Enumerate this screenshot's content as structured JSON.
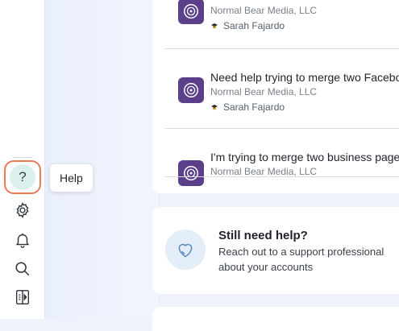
{
  "sidebar": {
    "help_tooltip": "Help",
    "icons": [
      "help-icon",
      "settings-icon",
      "bell-icon",
      "search-icon",
      "panel-toggle-icon"
    ]
  },
  "threads": [
    {
      "title": "",
      "org": "Normal Bear Media, LLC",
      "person": "Sarah Fajardo"
    },
    {
      "title": "Need help trying to merge two Facebook",
      "org": "Normal Bear Media, LLC",
      "person": "Sarah Fajardo"
    },
    {
      "title": "I'm trying to merge two business pages",
      "org": "Normal Bear Media, LLC",
      "person": ""
    }
  ],
  "help_card": {
    "title": "Still need help?",
    "description": "Reach out to a support professional about your accounts"
  },
  "colors": {
    "accent_border": "#ec7b54",
    "avatar": "#5b3f8a",
    "help_circle": "#dbf1ee"
  }
}
